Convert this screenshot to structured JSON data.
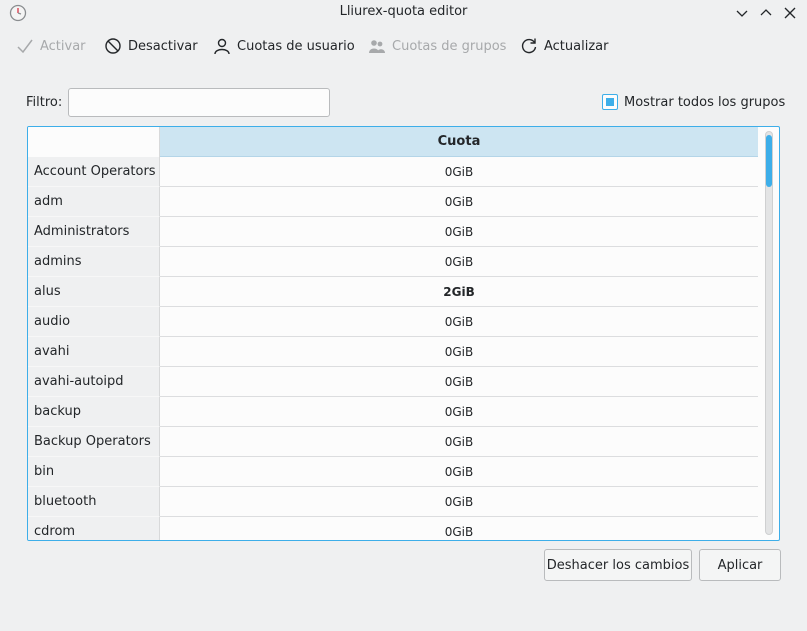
{
  "window": {
    "title": "Lliurex-quota editor",
    "icons": [
      "app-clock-icon",
      "minimize-icon",
      "maximize-icon",
      "close-icon"
    ]
  },
  "toolbar": {
    "activate": {
      "label": "Activar",
      "enabled": false,
      "icon": "check-icon"
    },
    "deactivate": {
      "label": "Desactivar",
      "enabled": true,
      "icon": "no-entry-icon"
    },
    "user_quotas": {
      "label": "Cuotas de usuario",
      "enabled": true,
      "icon": "user-icon"
    },
    "group_quotas": {
      "label": "Cuotas de grupos",
      "enabled": false,
      "icon": "group-icon"
    },
    "refresh": {
      "label": "Actualizar",
      "enabled": true,
      "icon": "refresh-icon"
    }
  },
  "filter": {
    "label": "Filtro:",
    "value": "",
    "placeholder": ""
  },
  "show_all_groups": {
    "label": "Mostrar todos los grupos",
    "checked": true
  },
  "table": {
    "columns": [
      "Cuota"
    ],
    "rows": [
      {
        "name": "Account Operators",
        "quota": "0GiB",
        "bold": false
      },
      {
        "name": "adm",
        "quota": "0GiB",
        "bold": false
      },
      {
        "name": "Administrators",
        "quota": "0GiB",
        "bold": false
      },
      {
        "name": "admins",
        "quota": "0GiB",
        "bold": false
      },
      {
        "name": "alus",
        "quota": "2GiB",
        "bold": true
      },
      {
        "name": "audio",
        "quota": "0GiB",
        "bold": false
      },
      {
        "name": "avahi",
        "quota": "0GiB",
        "bold": false
      },
      {
        "name": "avahi-autoipd",
        "quota": "0GiB",
        "bold": false
      },
      {
        "name": "backup",
        "quota": "0GiB",
        "bold": false
      },
      {
        "name": "Backup Operators",
        "quota": "0GiB",
        "bold": false
      },
      {
        "name": "bin",
        "quota": "0GiB",
        "bold": false
      },
      {
        "name": "bluetooth",
        "quota": "0GiB",
        "bold": false
      },
      {
        "name": "cdrom",
        "quota": "0GiB",
        "bold": false
      }
    ]
  },
  "buttons": {
    "undo": "Deshacer los cambios",
    "apply": "Aplicar"
  },
  "colors": {
    "accent": "#3daee9",
    "header_bg": "#cde5f2",
    "window_bg": "#eff0f1",
    "disabled_text": "#a7a9ab"
  }
}
